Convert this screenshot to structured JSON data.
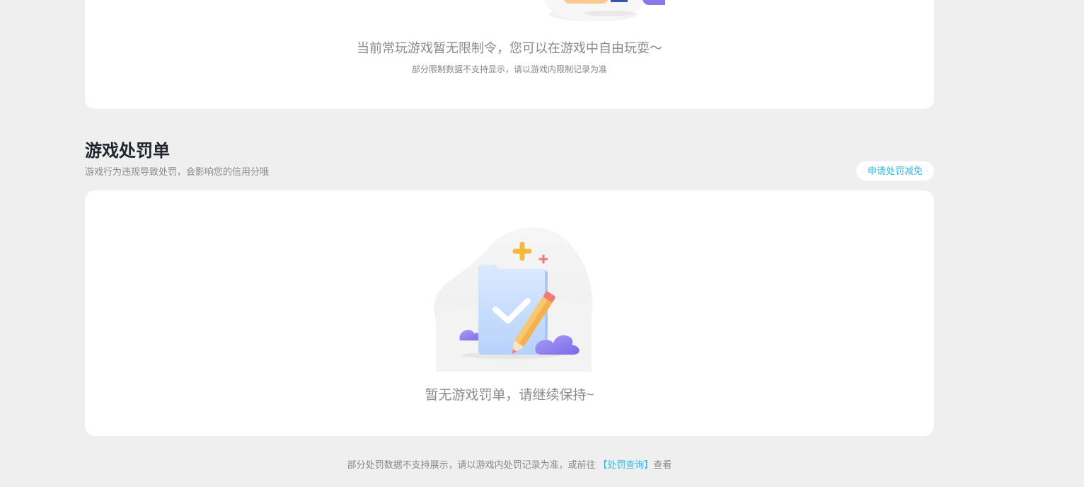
{
  "restriction": {
    "main_text": "当前常玩游戏暂无限制令，您可以在游戏中自由玩耍～",
    "sub_text": "部分限制数据不支持显示，请以游戏内限制记录为准"
  },
  "penalty_section": {
    "title": "游戏处罚单",
    "subtitle": "游戏行为违规导致处罚，会影响您的信用分哦",
    "apply_button": "申请处罚减免",
    "empty_text": "暂无游戏罚单，请继续保持~"
  },
  "footer": {
    "prefix": "部分处罚数据不支持展示，请以游戏内处罚记录为准，或前往",
    "link": "【处罚查询】",
    "suffix": "查看"
  },
  "colors": {
    "page_bg": "#efefef",
    "card_bg": "#ffffff",
    "accent_link": "#35b8e6",
    "title": "#1f232b",
    "muted_text": "#8a8a8a"
  },
  "icons": {
    "restriction_illustration": "hand-with-card-illustration",
    "empty_illustration": "clipboard-check-pencil-illustration"
  }
}
